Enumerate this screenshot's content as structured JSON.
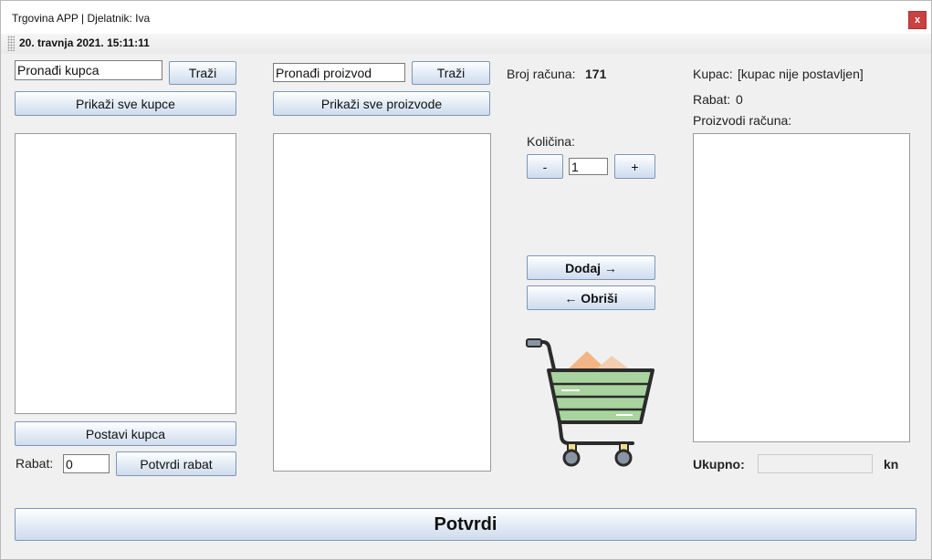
{
  "window": {
    "title": "Trgovina APP | Djelatnik: Iva",
    "close_label": "x"
  },
  "datebar": {
    "date": "20. travnja 2021. 15:11:11"
  },
  "customers": {
    "search_value": "Pronađi kupca",
    "search_button": "Traži",
    "show_all_button": "Prikaži sve kupce",
    "set_customer_button": "Postavi kupca",
    "rabat_label": "Rabat:",
    "rabat_value": "0",
    "confirm_rabat_button": "Potvrdi rabat"
  },
  "products": {
    "search_value": "Pronađi proizvod",
    "search_button": "Traži",
    "show_all_button": "Prikaži sve proizvode"
  },
  "invoice": {
    "number_label": "Broj računa:",
    "number_value": "171",
    "quantity_label": "Količina:",
    "minus_button": "-",
    "quantity_value": "1",
    "plus_button": "+",
    "add_button": "Dodaj →",
    "remove_button": "← Obriši"
  },
  "summary": {
    "customer_label": "Kupac:",
    "customer_value": "[kupac nije postavljen]",
    "rabat_label": "Rabat:",
    "rabat_value": "0",
    "products_label": "Proizvodi računa:",
    "total_label": "Ukupno:",
    "total_value": "",
    "currency": "kn"
  },
  "confirm_button": "Potvrdi",
  "icons": {
    "cart": "shopping-cart-icon",
    "grip": "toolbar-grip-icon"
  },
  "colors": {
    "button_border": "#7b98b6",
    "close_bg": "#c94141",
    "cart_green": "#a9d4a0",
    "cart_outline": "#2b2b2b"
  }
}
